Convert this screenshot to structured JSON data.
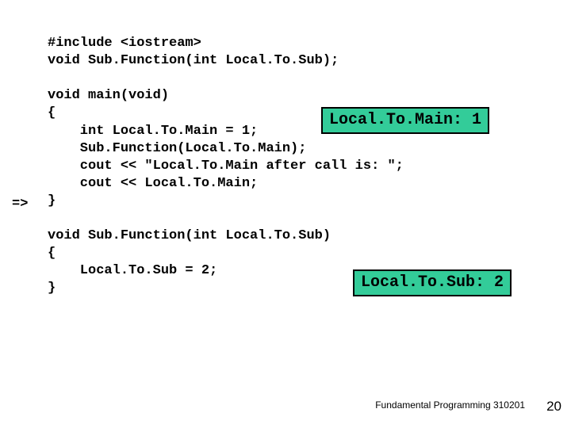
{
  "arrow": "=>",
  "code": {
    "l1": "#include <iostream>",
    "l2": "void Sub.Function(int Local.To.Sub);",
    "l3": "",
    "l4": "void main(void)",
    "l5": "{",
    "l6": "    int Local.To.Main = 1;",
    "l7": "    Sub.Function(Local.To.Main);",
    "l8": "    cout << \"Local.To.Main after call is: \";",
    "l9": "    cout << Local.To.Main;",
    "l10": "}",
    "l11": "",
    "l12": "void Sub.Function(int Local.To.Sub)",
    "l13": "{",
    "l14": "    Local.To.Sub = 2;",
    "l15": "}"
  },
  "box1": "Local.To.Main: 1",
  "box2": "Local.To.Sub: 2",
  "footer": "Fundamental Programming 310201",
  "page": "20"
}
